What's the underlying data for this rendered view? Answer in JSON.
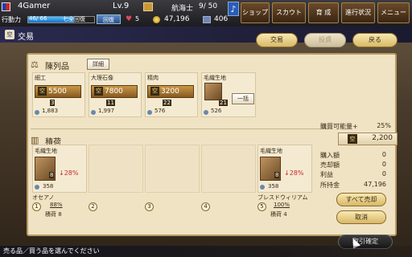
{
  "topbar": {
    "player_name": "4Gamer",
    "level": "Lv.9",
    "action_label": "行動力",
    "action_value": "46/ 66",
    "action_fill_fraction": 0.7,
    "action_status": "七全回復",
    "recover_label": "回復",
    "hearts": "5",
    "sailor_label": "航海士",
    "sailor_value": "9/ 50",
    "gold": "47,196",
    "cargo": "406",
    "menu": [
      "ショップ",
      "スカウト",
      "育 成",
      "進行状況",
      "メニュー"
    ]
  },
  "title": {
    "icon": "空",
    "text": "交易",
    "tabs": [
      "交易",
      "投資"
    ],
    "back": "戻る"
  },
  "goods": {
    "title": "陳列品",
    "detail": "詳細",
    "bulk": "一括",
    "coin_glyph": "空",
    "items": [
      {
        "name": "細工",
        "price": "5500",
        "qty": "3",
        "stock": "1,883"
      },
      {
        "name": "大理石像",
        "price": "7800",
        "qty": "11",
        "stock": "1,997"
      },
      {
        "name": "精肉",
        "price": "3200",
        "qty": "22",
        "stock": "576"
      },
      {
        "name": "毛織生地",
        "price": "",
        "qty": "21",
        "stock": "526"
      }
    ]
  },
  "cargo": {
    "title": "積荷",
    "slots": [
      {
        "name": "毛織生地",
        "qty": "8",
        "change": "↓28%",
        "stock": "358"
      },
      {
        "name": "",
        "qty": "",
        "change": "",
        "stock": ""
      },
      {
        "name": "",
        "qty": "",
        "change": "",
        "stock": ""
      },
      {
        "name": "",
        "qty": "",
        "change": "",
        "stock": ""
      },
      {
        "name": "毛織生地",
        "qty": "8",
        "change": "↓28%",
        "stock": "358"
      }
    ],
    "ports": [
      {
        "num": "1",
        "name": "オセアノ",
        "pct": "88%",
        "cargo": "積荷 8"
      },
      {
        "num": "2",
        "name": "",
        "pct": "",
        "cargo": ""
      },
      {
        "num": "3",
        "name": "",
        "pct": "",
        "cargo": ""
      },
      {
        "num": "4",
        "name": "",
        "pct": "",
        "cargo": ""
      },
      {
        "num": "5",
        "name": "ブレスドウィリアム",
        "pct": "100%",
        "cargo": "積荷 4"
      }
    ]
  },
  "info": {
    "capacity_label": "購買可能量+",
    "capacity_value": "25%",
    "coin_glyph": "空",
    "coin_value": "2,200",
    "rows": [
      {
        "label": "購入額",
        "value": "0"
      },
      {
        "label": "売却額",
        "value": "0"
      },
      {
        "label": "利益",
        "value": "0"
      },
      {
        "label": "所持金",
        "value": "47,196"
      }
    ],
    "sell_all": "すべて売却",
    "cancel": "取消"
  },
  "bottom": {
    "deal": "取引確定",
    "status": "売る品／買う品を選んでください"
  },
  "colors": {
    "accent_gold": "#d8b868",
    "panel_bg": "#efe3c4",
    "down_red": "#c8282c"
  }
}
